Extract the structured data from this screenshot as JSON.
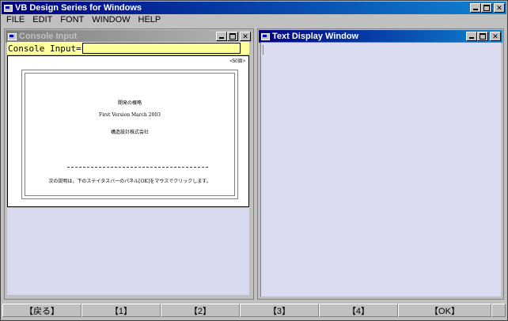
{
  "app": {
    "title": "VB Design Series for Windows"
  },
  "menu": [
    "FILE",
    "EDIT",
    "FONT",
    "WINDOW",
    "HELP"
  ],
  "console_window": {
    "title": "Console Input",
    "input_label": "Console Input=",
    "input_value": "",
    "page_number": "<50頁>",
    "document": {
      "title": "開発の概略",
      "version": "First Version March 2003",
      "company": "構造設計株式会社",
      "rule": "--------------------------------------------------------------",
      "note": "次の説明は，下のステイタスバーのパネル[OK]をマウスでクリックします。"
    }
  },
  "text_window": {
    "title": "Text Display Window"
  },
  "statusbar": [
    "【戻る】",
    "【1】",
    "【2】",
    "【3】",
    "【4】",
    "【OK】"
  ]
}
